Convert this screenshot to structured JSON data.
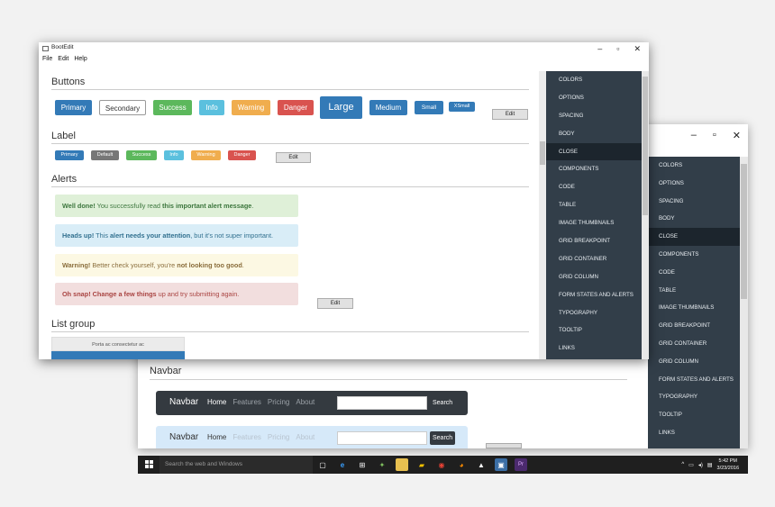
{
  "main_window": {
    "title": "BootEdit",
    "controls": {
      "minimize": "–",
      "maximize": "▫",
      "close": "✕"
    },
    "menu": [
      "File",
      "Edit",
      "Help"
    ],
    "sections": {
      "buttons": "Buttons",
      "label": "Label",
      "alerts": "Alerts",
      "list_group": "List group"
    },
    "buttons": [
      {
        "label": "Primary",
        "color": "#337ab7"
      },
      {
        "label": "Secondary",
        "color": "#ffffff"
      },
      {
        "label": "Success",
        "color": "#5cb85c"
      },
      {
        "label": "Info",
        "color": "#5bc0de"
      },
      {
        "label": "Warning",
        "color": "#f0ad4e"
      },
      {
        "label": "Danger",
        "color": "#d9534f"
      },
      {
        "label": "Large",
        "color": "#337ab7"
      },
      {
        "label": "Medium",
        "color": "#337ab7"
      },
      {
        "label": "Small",
        "color": "#337ab7"
      },
      {
        "label": "XSmall",
        "color": "#337ab7"
      }
    ],
    "labels": [
      {
        "label": "Primary",
        "color": "#337ab7"
      },
      {
        "label": "Default",
        "color": "#777777"
      },
      {
        "label": "Success",
        "color": "#5cb85c"
      },
      {
        "label": "Info",
        "color": "#5bc0de"
      },
      {
        "label": "Warning",
        "color": "#f0ad4e"
      },
      {
        "label": "Danger",
        "color": "#d9534f"
      }
    ],
    "edit_label": "Edit",
    "alerts": [
      {
        "strong": "Well done!",
        "text1": " You successfully read ",
        "bold2": "this important alert message",
        "text2": ".",
        "bg": "#dff0d8",
        "fg": "#3c763d"
      },
      {
        "strong": "Heads up!",
        "text1": " This ",
        "bold2": "alert needs your attention",
        "text2": ", but it's not super important.",
        "bg": "#d9edf7",
        "fg": "#31708f"
      },
      {
        "strong": "Warning!",
        "text1": " Better check yourself, you're ",
        "bold2": "not looking too good",
        "text2": ".",
        "bg": "#fcf8e3",
        "fg": "#8a6d3b"
      },
      {
        "strong": "Oh snap!",
        "text1": " ",
        "bold2": "Change a few things",
        "text2": " up and try submitting again.",
        "bg": "#f2dede",
        "fg": "#a94442"
      }
    ],
    "list_group_item": "Porta ac consectetur ac",
    "sidebar": [
      "COLORS",
      "OPTIONS",
      "SPACING",
      "BODY",
      "CLOSE",
      "COMPONENTS",
      "CODE",
      "TABLE",
      "IMAGE THUMBNAILS",
      "GRID BREAKPOINT",
      "GRID CONTAINER",
      "GRID COLUMN",
      "FORM STATES AND ALERTS",
      "TYPOGRAPHY",
      "TOOLTIP",
      "LINKS"
    ],
    "sidebar_active": "CLOSE"
  },
  "back_window": {
    "controls": {
      "minimize": "–",
      "maximize": "▫",
      "close": "✕"
    },
    "sidebar": [
      "COLORS",
      "OPTIONS",
      "SPACING",
      "BODY",
      "CLOSE",
      "COMPONENTS",
      "CODE",
      "TABLE",
      "IMAGE THUMBNAILS",
      "GRID BREAKPOINT",
      "GRID CONTAINER",
      "GRID COLUMN",
      "FORM STATES AND ALERTS",
      "TYPOGRAPHY",
      "TOOLTIP",
      "LINKS"
    ],
    "navbar_section": "Navbar",
    "navbar_dark": {
      "brand": "Navbar",
      "links": [
        "Home",
        "Features",
        "Pricing",
        "About"
      ],
      "search_button": "Search"
    },
    "navbar_light": {
      "brand": "Navbar",
      "links": [
        "Home",
        "Features",
        "Pricing",
        "About"
      ],
      "search_button": "Search"
    }
  },
  "taskbar": {
    "search_placeholder": "Search the web and Windows",
    "app_icons": [
      "task-view-icon",
      "edge-icon",
      "store-icon",
      "app-icon",
      "explorer-icon",
      "folder-icon",
      "chrome-icon",
      "firefox-icon",
      "app2-icon",
      "bootedit-icon",
      "premiere-icon"
    ],
    "time": "5:42 PM",
    "date": "3/23/2016"
  }
}
